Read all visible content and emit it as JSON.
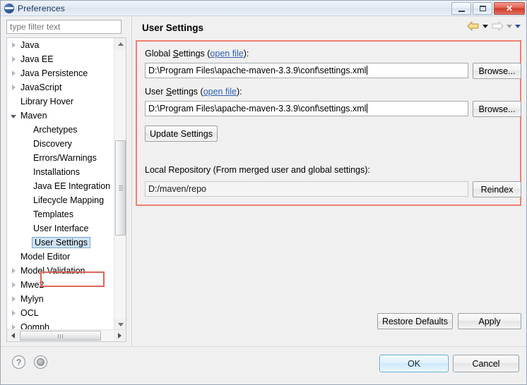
{
  "window": {
    "title": "Preferences",
    "icon": "eclipse-icon",
    "controls": {
      "minimize": "minimize-icon",
      "maximize": "maximize-icon",
      "close": "✕"
    }
  },
  "sidebar": {
    "filter": {
      "placeholder": "type filter text",
      "value": ""
    },
    "items": [
      {
        "label": "Java",
        "level": 0,
        "state": "collapsed",
        "selected": false
      },
      {
        "label": "Java EE",
        "level": 0,
        "state": "collapsed",
        "selected": false
      },
      {
        "label": "Java Persistence",
        "level": 0,
        "state": "collapsed",
        "selected": false
      },
      {
        "label": "JavaScript",
        "level": 0,
        "state": "collapsed",
        "selected": false
      },
      {
        "label": "Library Hover",
        "level": 0,
        "state": "leaf",
        "selected": false
      },
      {
        "label": "Maven",
        "level": 0,
        "state": "expanded",
        "selected": false
      },
      {
        "label": "Archetypes",
        "level": 1,
        "state": "leaf",
        "selected": false
      },
      {
        "label": "Discovery",
        "level": 1,
        "state": "leaf",
        "selected": false
      },
      {
        "label": "Errors/Warnings",
        "level": 1,
        "state": "leaf",
        "selected": false
      },
      {
        "label": "Installations",
        "level": 1,
        "state": "leaf",
        "selected": false
      },
      {
        "label": "Java EE Integration",
        "level": 1,
        "state": "leaf",
        "selected": false
      },
      {
        "label": "Lifecycle Mapping",
        "level": 1,
        "state": "leaf",
        "selected": false
      },
      {
        "label": "Templates",
        "level": 1,
        "state": "leaf",
        "selected": false
      },
      {
        "label": "User Interface",
        "level": 1,
        "state": "leaf",
        "selected": false
      },
      {
        "label": "User Settings",
        "level": 1,
        "state": "leaf",
        "selected": true
      },
      {
        "label": "Model Editor",
        "level": 0,
        "state": "leaf",
        "selected": false
      },
      {
        "label": "Model Validation",
        "level": 0,
        "state": "collapsed",
        "selected": false
      },
      {
        "label": "Mwe2",
        "level": 0,
        "state": "collapsed",
        "selected": false
      },
      {
        "label": "Mylyn",
        "level": 0,
        "state": "collapsed",
        "selected": false
      },
      {
        "label": "OCL",
        "level": 0,
        "state": "collapsed",
        "selected": false
      },
      {
        "label": "Oomph",
        "level": 0,
        "state": "collapsed",
        "selected": false
      }
    ]
  },
  "page": {
    "title": "User Settings",
    "nav": {
      "back": "back-arrow-icon",
      "back_menu": "chevron-down-icon",
      "forward": "forward-arrow-icon",
      "forward_menu": "chevron-down-icon",
      "view_menu": "chevron-down-icon"
    },
    "global_settings": {
      "label_prefix": "Global ",
      "label_mnemonic": "S",
      "label_rest": "ettings (",
      "link": "open file",
      "label_suffix": "):",
      "value": "D:\\Program Files\\apache-maven-3.3.9\\conf\\settings.xml",
      "browse_label": "Browse..."
    },
    "user_settings": {
      "label_prefix": "User ",
      "label_mnemonic": "S",
      "label_rest": "ettings (",
      "link": "open file",
      "label_suffix": "):",
      "value": "D:\\Program Files\\apache-maven-3.3.9\\conf\\settings.xml",
      "browse_label": "Browse..."
    },
    "update_settings_label": "Update Settings",
    "local_repository": {
      "label": "Local Repository (From merged user and global settings):",
      "value": "D:/maven/repo",
      "reindex_label": "Reindex"
    },
    "restore_defaults_label": "Restore Defaults",
    "apply_label": "Apply"
  },
  "footer": {
    "help_icon": "?",
    "about_icon": "about-icon",
    "ok_label": "OK",
    "cancel_label": "Cancel"
  },
  "colors": {
    "annotation_red": "#ef7f72",
    "selection_blue": "#cfe3f5",
    "link_blue": "#2f5fb5",
    "default_button_blue": "#5ea8d6"
  }
}
